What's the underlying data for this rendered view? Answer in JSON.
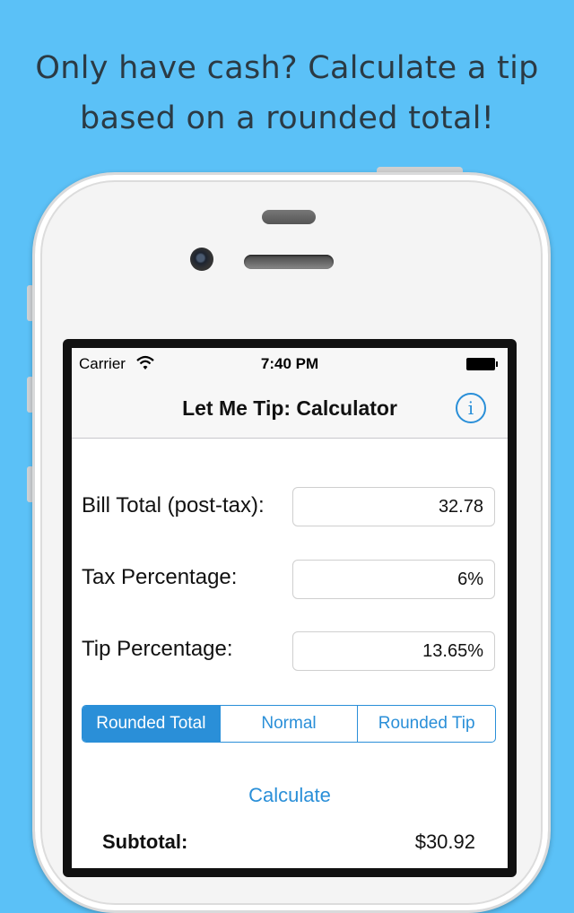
{
  "headline": {
    "line1": "Only have cash? Calculate a tip",
    "line2": "based on a rounded total!"
  },
  "status_bar": {
    "carrier": "Carrier",
    "time": "7:40 PM"
  },
  "nav": {
    "title": "Let Me Tip: Calculator",
    "info_icon": "i"
  },
  "form": {
    "bill_total": {
      "label": "Bill Total (post-tax):",
      "value": "32.78"
    },
    "tax_percentage": {
      "label": "Tax Percentage:",
      "value": "6%"
    },
    "tip_percentage": {
      "label": "Tip Percentage:",
      "value": "13.65%"
    }
  },
  "mode_selector": {
    "options": [
      "Rounded Total",
      "Normal",
      "Rounded Tip"
    ],
    "selected": "Rounded Total"
  },
  "calculate_label": "Calculate",
  "results": {
    "subtotal_label": "Subtotal:",
    "subtotal_value": "$30.92"
  },
  "colors": {
    "background": "#5bc1f7",
    "accent": "#2a8fd8"
  }
}
